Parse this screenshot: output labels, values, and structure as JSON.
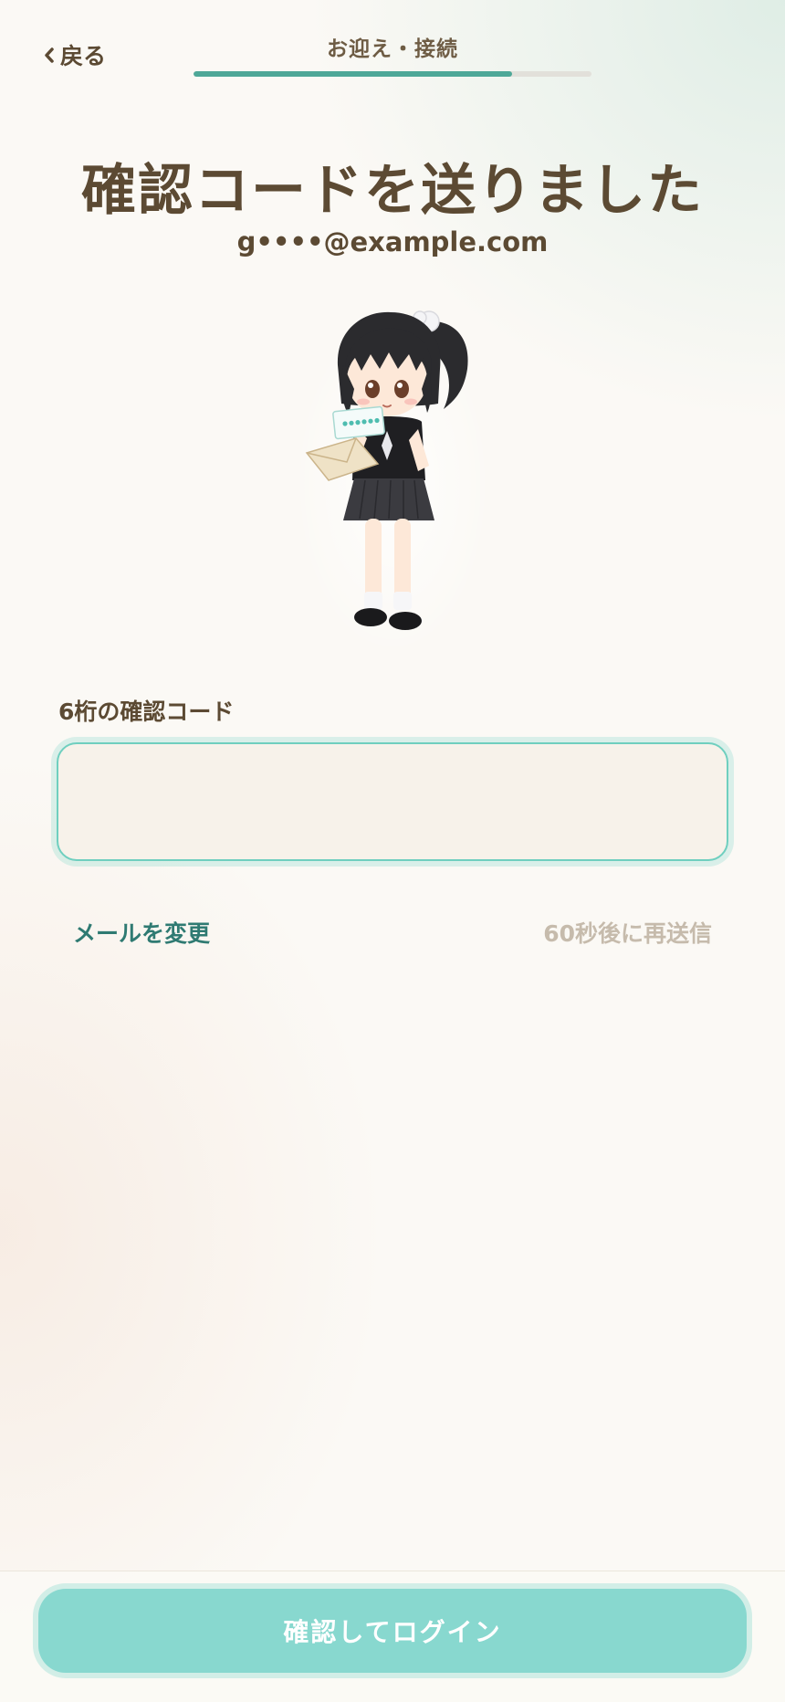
{
  "header": {
    "back_label": "戻る",
    "step_title": "お迎え・接続",
    "progress": 0.8
  },
  "main": {
    "title": "確認コードを送りました",
    "email": "g••••@example.com",
    "code_field": {
      "label": "6桁の確認コード",
      "value": "",
      "placeholder": ""
    },
    "change_email_label": "メールを変更",
    "resend_label": "60秒後に再送信"
  },
  "footer": {
    "login_button_label": "確認してログイン"
  },
  "colors": {
    "accent": "#4ea898",
    "title_brown": "#5c4a33",
    "link_teal": "#2f7a72",
    "disabled_text": "#c6bbac",
    "button_bg": "#88d8cf",
    "input_border": "#6fcfbf",
    "background": "#fbf9f5"
  },
  "icons": {
    "back": "chevron-left-icon",
    "mascot": "mascot-illustration"
  }
}
